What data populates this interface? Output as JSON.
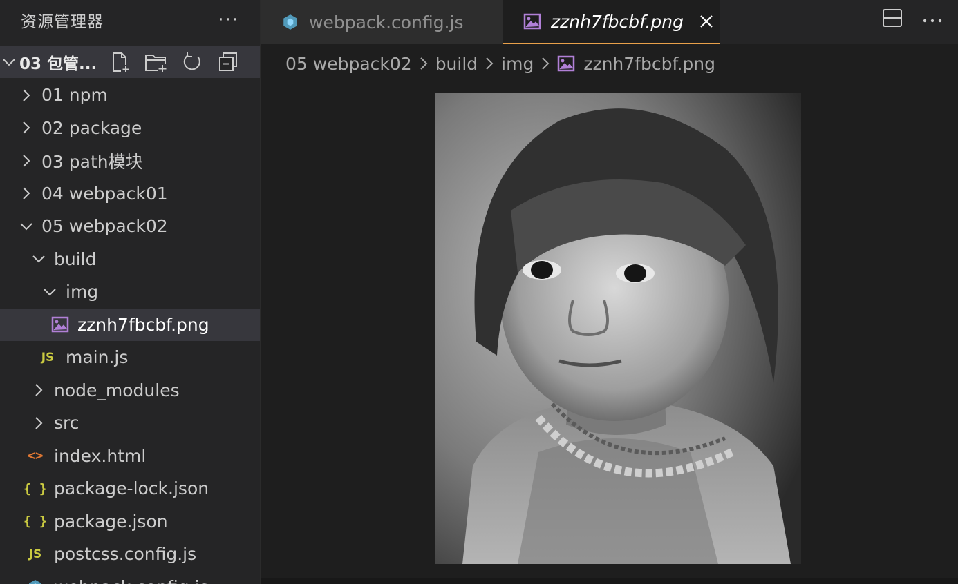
{
  "sidebar": {
    "title": "资源管理器",
    "more_label": "···",
    "folder": {
      "name": "03 包管..."
    },
    "items": [
      {
        "label": "01 npm"
      },
      {
        "label": "02 package"
      },
      {
        "label": "03 path模块"
      },
      {
        "label": "04 webpack01"
      },
      {
        "label": "05 webpack02"
      },
      {
        "label": "build"
      },
      {
        "label": "img"
      },
      {
        "label": "zznh7fbcbf.png"
      },
      {
        "label": "main.js"
      },
      {
        "label": "node_modules"
      },
      {
        "label": "src"
      },
      {
        "label": "index.html"
      },
      {
        "label": "package-lock.json"
      },
      {
        "label": "package.json"
      },
      {
        "label": "postcss.config.js"
      },
      {
        "label": "webpack.config.js"
      }
    ],
    "icon_labels": {
      "js": "JS",
      "json": "{ }",
      "html": "<>"
    }
  },
  "tabs": [
    {
      "label": "webpack.config.js",
      "active": false
    },
    {
      "label": "zznh7fbcbf.png",
      "active": true
    }
  ],
  "breadcrumb": [
    "05 webpack02",
    "build",
    "img",
    "zznh7fbcbf.png"
  ],
  "colors": {
    "accent_tab_border": "#e8a04a",
    "image_icon": "#b180d7",
    "js_icon": "#cbcb41",
    "html_icon": "#e37933",
    "webpack_icon": "#519aba"
  }
}
